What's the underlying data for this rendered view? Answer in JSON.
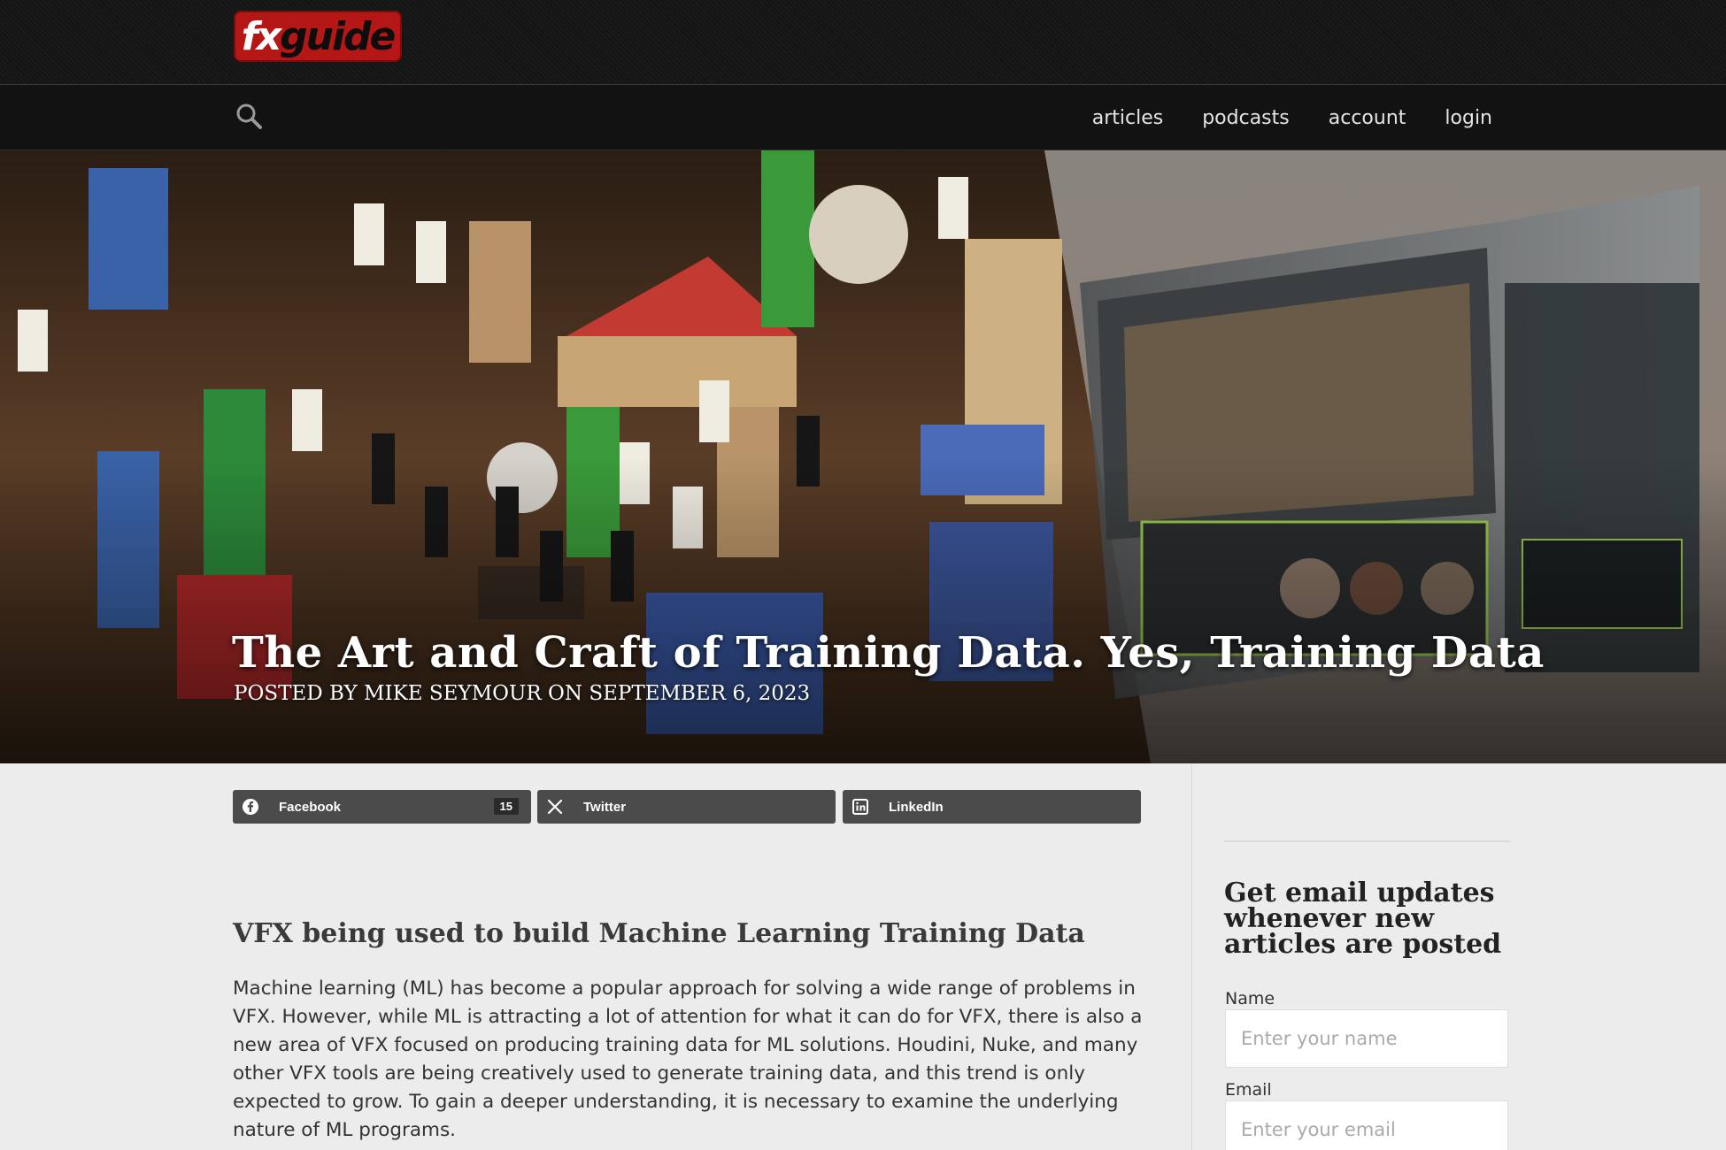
{
  "site": {
    "logo_fx": "fx",
    "logo_guide": "guide"
  },
  "nav": {
    "items": [
      {
        "label": "articles"
      },
      {
        "label": "podcasts"
      },
      {
        "label": "account"
      },
      {
        "label": "login"
      }
    ]
  },
  "hero": {
    "title": "The Art and Craft of Training Data. Yes, Training Data",
    "byline": "POSTED BY MIKE SEYMOUR ON SEPTEMBER 6, 2023"
  },
  "share": {
    "facebook_label": "Facebook",
    "facebook_count": "15",
    "twitter_label": "Twitter",
    "linkedin_label": "LinkedIn"
  },
  "article": {
    "heading": "VFX being used to build Machine Learning Training Data",
    "paragraph": "Machine learning (ML) has become a popular approach for solving a wide range of problems in VFX. However, while ML is attracting a lot of attention for what it can do for VFX, there is also a new area of VFX focused on producing training data for ML solutions. Houdini, Nuke, and many other VFX tools are being creatively used to generate training data, and this trend is only expected to grow. To gain a deeper understanding, it is necessary to examine the underlying nature of ML programs."
  },
  "sidebar": {
    "title": "Get email updates whenever new articles are posted",
    "name_label": "Name",
    "name_placeholder": "Enter your name",
    "email_label": "Email",
    "email_placeholder": "Enter your email"
  },
  "colors": {
    "logo_red": "#b51616",
    "nav_bg": "#121212",
    "share_bg": "#4b4b4b"
  },
  "icons": [
    "search-icon",
    "facebook-icon",
    "x-twitter-icon",
    "linkedin-icon"
  ]
}
